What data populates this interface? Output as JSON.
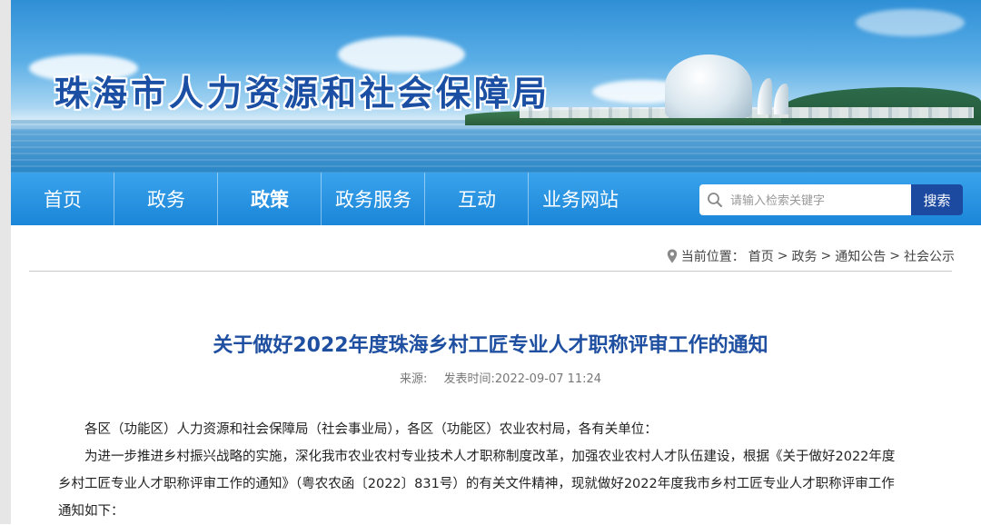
{
  "header": {
    "site_title": "珠海市人力资源和社会保障局"
  },
  "nav": {
    "items": [
      {
        "label": "首页"
      },
      {
        "label": "政务"
      },
      {
        "label": "政策"
      },
      {
        "label": "政务服务"
      },
      {
        "label": "互动"
      },
      {
        "label": "业务网站"
      }
    ],
    "active_index": 2
  },
  "search": {
    "placeholder": "请输入检索关键字",
    "button_label": "搜索",
    "icon": "search-icon"
  },
  "breadcrumb": {
    "label": "当前位置：",
    "items": [
      "首页",
      "政务",
      "通知公告",
      "社会公示"
    ],
    "separator": " > ",
    "icon": "location-pin-icon"
  },
  "article": {
    "title": "关于做好2022年度珠海乡村工匠专业人才职称评审工作的通知",
    "source_label": "来源:",
    "publish_time": "发表时间:2022-09-07 11:24",
    "paragraphs": [
      "各区（功能区）人力资源和社会保障局（社会事业局），各区（功能区）农业农村局，各有关单位：",
      "为进一步推进乡村振兴战略的实施，深化我市农业农村专业技术人才职称制度改革，加强农业农村人才队伍建设，根据《关于做好2022年度",
      "乡村工匠专业人才职称评审工作的通知》（粤农农函〔2022〕831号）的有关文件精神，现就做好2022年度我市乡村工匠专业人才职称评审工作",
      "通知如下："
    ]
  },
  "colors": {
    "nav_bg": "#1b86d8",
    "search_button": "#1c4aa0",
    "title_blue": "#1f4fa0",
    "site_title": "#1a4fa3"
  }
}
